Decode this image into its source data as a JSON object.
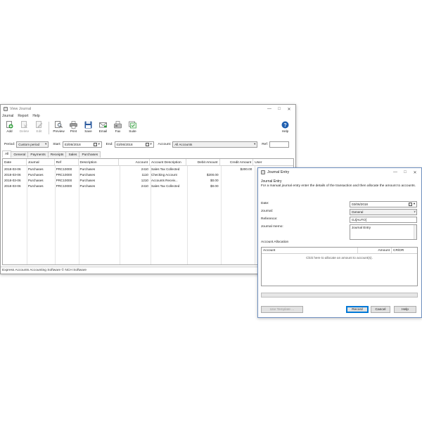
{
  "main_window": {
    "title": "View Journal",
    "menu": [
      "Journal",
      "Report",
      "Help"
    ],
    "toolbar": {
      "add": "Add",
      "delete": "Delete",
      "edit": "Edit",
      "preview": "Preview",
      "print": "Print",
      "save": "Save",
      "email": "Email",
      "fax": "Fax",
      "suite": "Suite",
      "help": "Help"
    },
    "filters": {
      "period_label": "Period:",
      "period_value": "Custom period",
      "start_label": "Start:",
      "start_value": "03/06/2018",
      "end_label": "End:",
      "end_value": "03/06/2018",
      "account_label": "Account:",
      "account_value": "All Accounts",
      "ref_label": "Ref:",
      "ref_value": ""
    },
    "tabs": [
      "All",
      "General",
      "Payments",
      "Receipts",
      "Sales",
      "Purchases"
    ],
    "columns": [
      "Date",
      "Journal",
      "Ref",
      "Description",
      "Account",
      "Account Description",
      "Debit Amount",
      "Credit Amount",
      "User"
    ],
    "rows": [
      [
        "2018-03-06",
        "Purchases",
        "PRC10000",
        "Purchases",
        "2410",
        "Sales Tax Collected",
        "",
        "$200.00",
        ""
      ],
      [
        "2018-03-06",
        "Purchases",
        "PRC10000",
        "Purchases",
        "1110",
        "Checking Account",
        "$200.00",
        "",
        ""
      ],
      [
        "2018-03-06",
        "Purchases",
        "PRC10000",
        "Purchases",
        "1210",
        "Accounts Receiv...",
        "$0.00",
        "",
        ""
      ],
      [
        "2018-03-06",
        "Purchases",
        "PRC10000",
        "Purchases",
        "2410",
        "Sales Tax Collected",
        "$0.00",
        "",
        ""
      ]
    ],
    "status": "Express Accounts Accounting Software © NCH Software"
  },
  "dialog": {
    "title": "Journal Entry",
    "section": "Journal Entry",
    "instructions": "For a manual journal entry enter the details of the transaction and then allocate the amount to accounts.",
    "date_label": "Date:",
    "date_value": "03/06/2018",
    "journal_label": "Journal:",
    "journal_value": "General",
    "reference_label": "Reference:",
    "reference_value": "GJ[AUTO]",
    "memo_label": "Journal memo:",
    "memo_value": "Journal Entry",
    "allocation_label": "Account Allocation",
    "allocation_columns": [
      "Account",
      "Amount",
      "CR/DR"
    ],
    "allocation_hint": "Click here to allocate an amount to account(s).",
    "buttons": {
      "template": "Use Template ...",
      "record": "Record",
      "cancel": "Cancel",
      "help": "Help"
    }
  },
  "colors": {
    "accent": "#0078d7",
    "dialog_border": "#6e8fbf"
  }
}
